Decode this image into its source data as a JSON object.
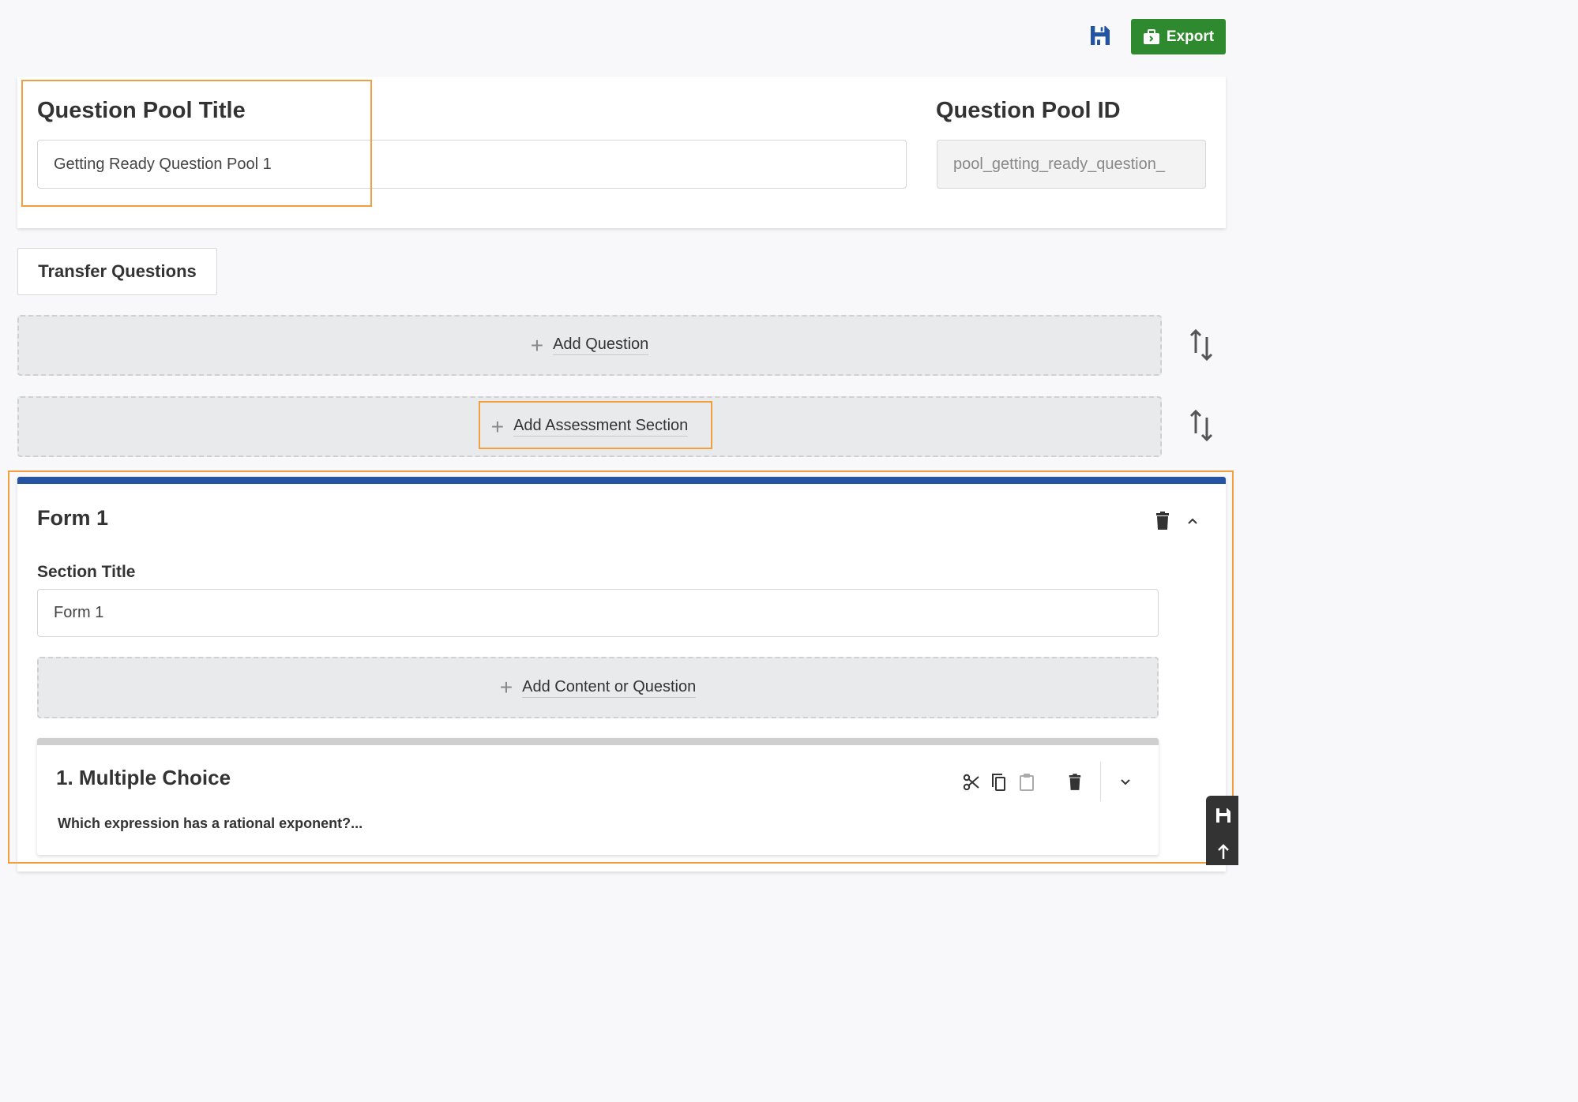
{
  "toolbar": {
    "save_icon": "floppy-disk-icon",
    "export_label": "Export",
    "export_icon": "briefcase-export-icon",
    "export_color": "#2f8a2f",
    "save_color": "#2454a2"
  },
  "pool": {
    "title_label": "Question Pool Title",
    "title_value": "Getting Ready Question Pool 1",
    "id_label": "Question Pool ID",
    "id_value": "pool_getting_ready_question_"
  },
  "actions": {
    "transfer_label": "Transfer Questions",
    "add_question_label": "Add Question",
    "add_section_label": "Add Assessment Section"
  },
  "section": {
    "heading": "Form 1",
    "title_label": "Section Title",
    "title_value": "Form 1",
    "add_content_label": "Add Content or Question",
    "accent_color": "#2454a2"
  },
  "question": {
    "title": "1. Multiple Choice",
    "prompt": "Which expression has a rational exponent?..."
  },
  "highlight_color": "#f0a040"
}
